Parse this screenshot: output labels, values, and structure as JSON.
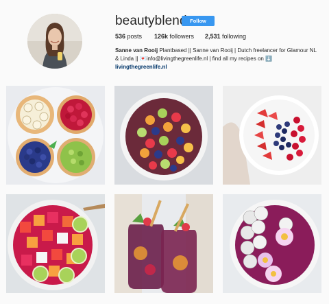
{
  "profile": {
    "username": "beautyblends",
    "follow_label": "Follow",
    "posts_count": "536",
    "posts_label": "posts",
    "followers_count": "126k",
    "followers_label": "followers",
    "following_count": "2,531",
    "following_label": "following",
    "full_name": "Sanne van Rooij",
    "bio_line1": "Plantbased || Sanne van Rooij | Dutch freelancer for Glamour NL",
    "bio_line2": "& Linda || 💌info@livingthegreenlife.nl | find all my recipes on ⬇️",
    "website": "livingthegreenlife.nl"
  },
  "posts": [
    {
      "subject": "bagels with banana, raspberry, blueberry and kiwi toppings"
    },
    {
      "subject": "fruit salad bowl"
    },
    {
      "subject": "strawberry and blueberry bowl"
    },
    {
      "subject": "watermelon, mango and dragonfruit bowl"
    },
    {
      "subject": "jars of fruit sangria"
    },
    {
      "subject": "purple smoothie bowl with dragonfruit balls and flowers"
    }
  ],
  "colors": {
    "accent": "#3897f0",
    "link": "#003569",
    "background": "#fafafa"
  }
}
